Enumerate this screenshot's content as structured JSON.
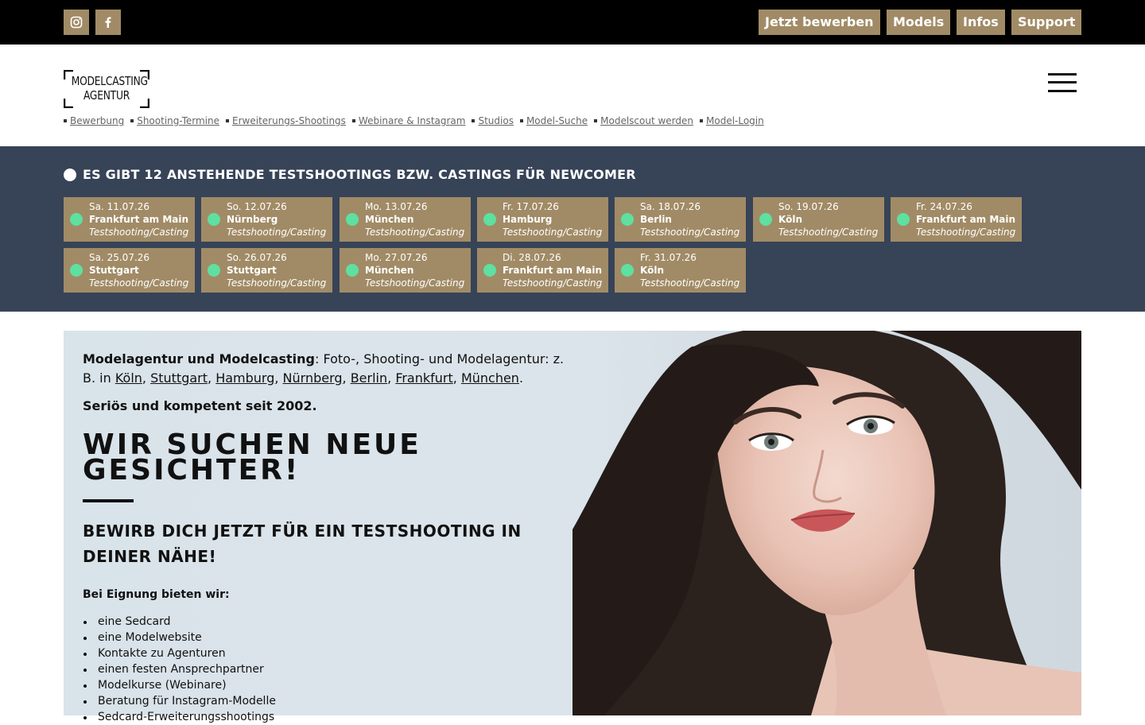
{
  "topbar": {
    "social": [
      {
        "name": "instagram-icon"
      },
      {
        "name": "facebook-icon"
      }
    ],
    "buttons": [
      "Jetzt bewerben",
      "Models",
      "Infos",
      "Support"
    ]
  },
  "header": {
    "logo_line1": "MODELCASTING",
    "logo_line2": "AGENTUR",
    "subnav": [
      "Bewerbung",
      "Shooting-Termine",
      "Erweiterungs-Shootings",
      "Webinare & Instagram",
      "Studios",
      "Model-Suche",
      "Modelscout werden",
      "Model-Login"
    ]
  },
  "events": {
    "title": "ES GIBT 12 ANSTEHENDE TESTSHOOTINGS BZW. CASTINGS FÜR NEWCOMER",
    "items": [
      {
        "date": "Sa. 11.07.26",
        "city": "Frankfurt am Main",
        "type": "Testshooting/Casting"
      },
      {
        "date": "So. 12.07.26",
        "city": "Nürnberg",
        "type": "Testshooting/Casting"
      },
      {
        "date": "Mo. 13.07.26",
        "city": "München",
        "type": "Testshooting/Casting"
      },
      {
        "date": "Fr. 17.07.26",
        "city": "Hamburg",
        "type": "Testshooting/Casting"
      },
      {
        "date": "Sa. 18.07.26",
        "city": "Berlin",
        "type": "Testshooting/Casting"
      },
      {
        "date": "So. 19.07.26",
        "city": "Köln",
        "type": "Testshooting/Casting"
      },
      {
        "date": "Fr. 24.07.26",
        "city": "Frankfurt am Main",
        "type": "Testshooting/Casting"
      },
      {
        "date": "Sa. 25.07.26",
        "city": "Stuttgart",
        "type": "Testshooting/Casting"
      },
      {
        "date": "So. 26.07.26",
        "city": "Stuttgart",
        "type": "Testshooting/Casting"
      },
      {
        "date": "Mo. 27.07.26",
        "city": "München",
        "type": "Testshooting/Casting"
      },
      {
        "date": "Di. 28.07.26",
        "city": "Frankfurt am Main",
        "type": "Testshooting/Casting"
      },
      {
        "date": "Fr. 31.07.26",
        "city": "Köln",
        "type": "Testshooting/Casting"
      }
    ]
  },
  "hero": {
    "intro_bold": "Modelagentur und Modelcasting",
    "intro_rest": ": Foto-, Shooting- und Modelagentur: z. B. in ",
    "cities": [
      "Köln",
      "Stuttgart",
      "Hamburg",
      "Nürnberg",
      "Berlin",
      "Frankfurt",
      "München"
    ],
    "since": "Seriös und kompetent seit 2002.",
    "headline": "WIR SUCHEN NEUE GESICHTER!",
    "subheadline": "BEWIRB DICH JETZT FÜR EIN TESTSHOOTING IN DEINER NÄHE!",
    "offer_title": "Bei Eignung bieten wir:",
    "offers": [
      "eine Sedcard",
      "eine Modelwebsite",
      "Kontakte zu Agenturen",
      "einen festen Ansprechpartner",
      "Modelkurse (Webinare)",
      "Beratung für Instagram-Modelle",
      "Sedcard-Erweiterungsshootings"
    ]
  },
  "colors": {
    "topbar_bg": "#000000",
    "accent_gold": "#a18b66",
    "events_bg": "#374357",
    "status_green": "#5ee0a0"
  }
}
